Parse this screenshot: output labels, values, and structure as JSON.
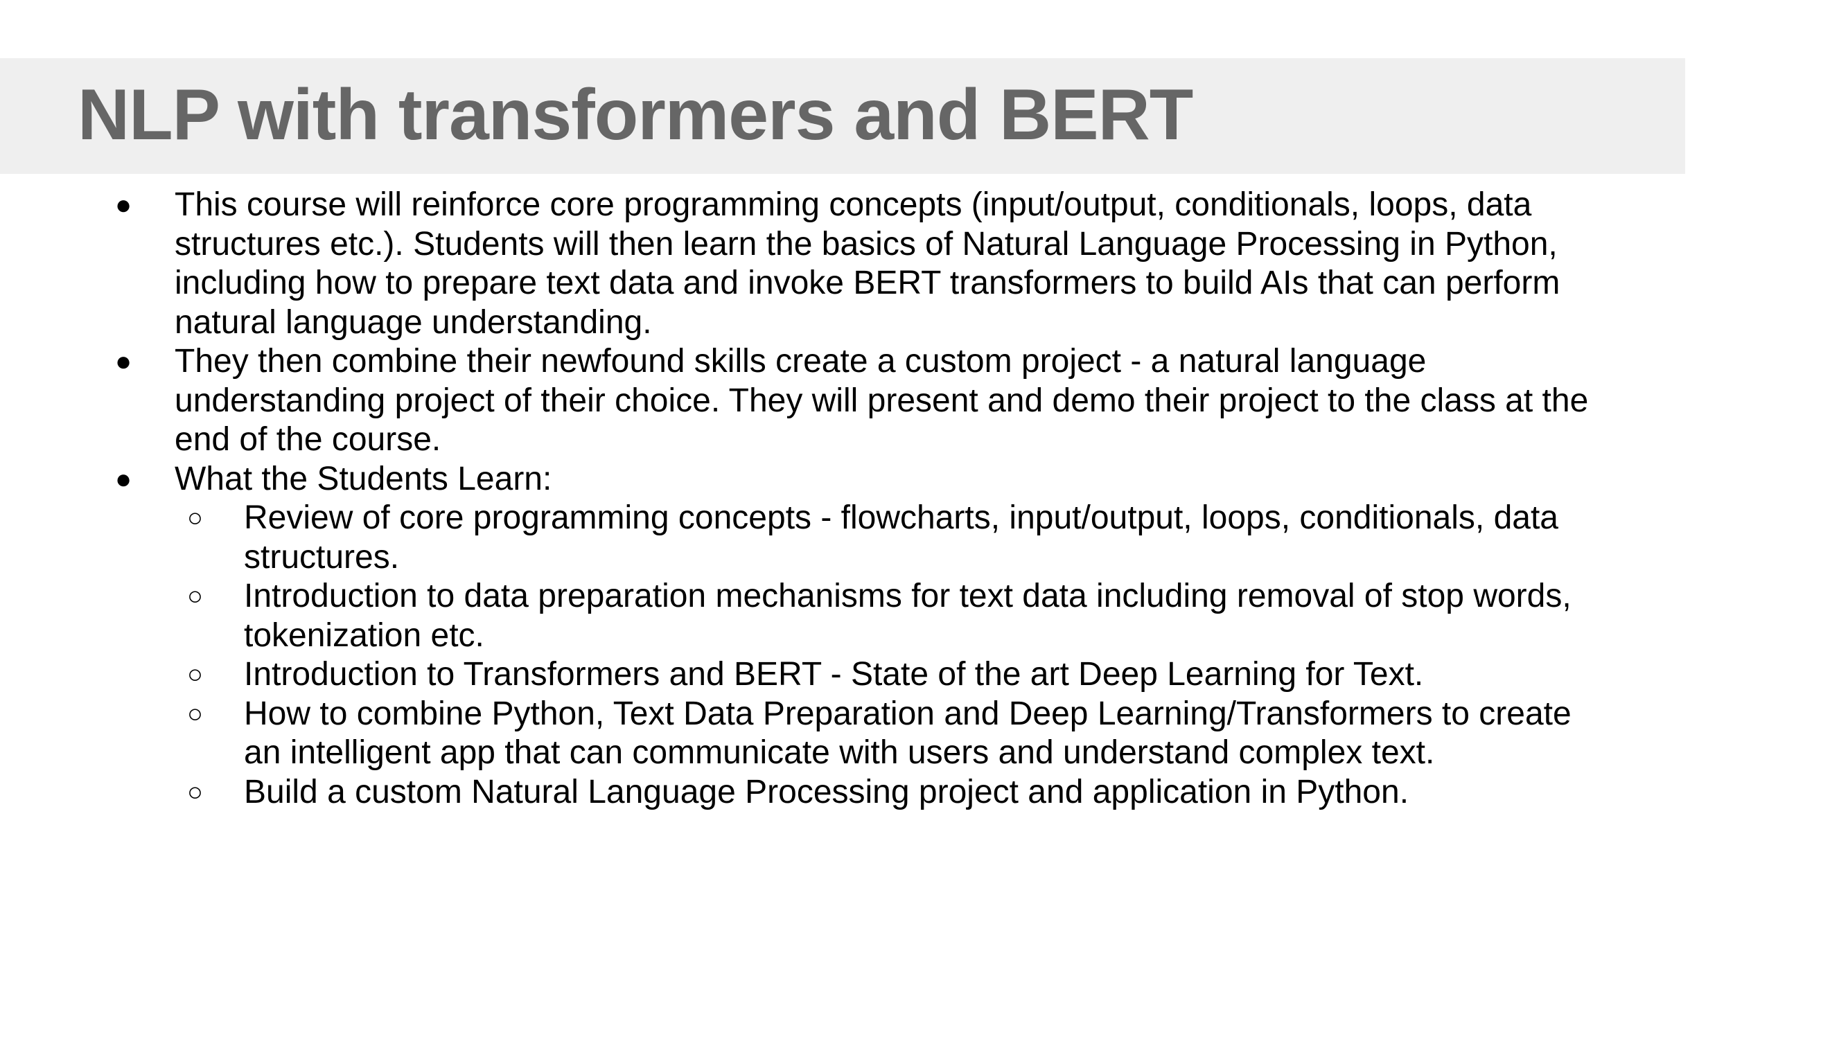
{
  "slide": {
    "title": "NLP with transformers and BERT"
  },
  "bullets": {
    "filled_glyph": "●",
    "hollow_glyph": "○",
    "items": [
      "This course will reinforce core programming concepts (input/output, conditionals, loops, data structures etc.). Students will then learn the basics of Natural Language Processing in Python, including how to prepare text data and invoke BERT transformers to build AIs that can perform natural language understanding.",
      "They then combine their newfound skills create a custom project - a natural language understanding project of their choice. They will present and demo their project to the class at the end of the course.",
      "What the Students Learn:"
    ],
    "sub_items": [
      "Review of core programming concepts - flowcharts, input/output, loops, conditionals, data structures.",
      "Introduction to data preparation mechanisms for text data including removal of stop words, tokenization etc.",
      "Introduction to Transformers and BERT - State of the art Deep Learning for Text.",
      "How to combine Python, Text Data Preparation and Deep Learning/Transformers to create an intelligent app that can communicate with users and understand complex text.",
      "Build a custom Natural Language Processing project and application in Python."
    ]
  },
  "colors": {
    "title_band": "#efefef",
    "title_text": "#666666",
    "body_text": "#000000"
  }
}
